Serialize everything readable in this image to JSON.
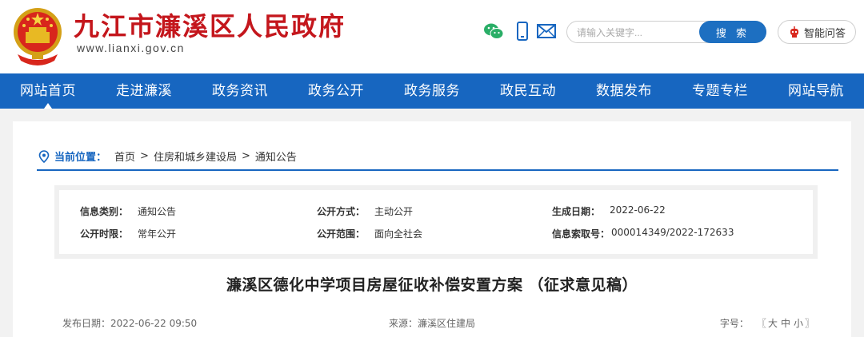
{
  "header": {
    "site_title": "九江市濂溪区人民政府",
    "site_domain": "www.lianxi.gov.cn",
    "icons": [
      "wechat-icon",
      "mobile-icon",
      "mail-icon"
    ],
    "search": {
      "placeholder": "请输入关键字...",
      "button_label": "搜 索"
    },
    "qa_label": "智能问答",
    "colors": {
      "title_red": "#c4161c",
      "nav_blue": "#1766c0",
      "search_blue": "#1d6fc1",
      "wechat_green": "#2aae67"
    }
  },
  "nav": {
    "items": [
      "网站首页",
      "走进濂溪",
      "政务资讯",
      "政务公开",
      "政务服务",
      "政民互动",
      "数据发布",
      "专题专栏",
      "网站导航"
    ],
    "active": "网站首页"
  },
  "breadcrumb": {
    "label": "当前位置：",
    "items": [
      "首页",
      "住房和城乡建设局",
      "通知公告"
    ],
    "separator": ">"
  },
  "info": {
    "category_key": "信息类别：",
    "category_val": "通知公告",
    "method_key": "公开方式：",
    "method_val": "主动公开",
    "date_key": "生成日期：",
    "date_val": "2022-06-22",
    "period_key": "公开时限：",
    "period_val": "常年公开",
    "scope_key": "公开范围：",
    "scope_val": "面向全社会",
    "index_key": "信息索取号：",
    "index_val": "000014349/2022-172633"
  },
  "article": {
    "title": "濂溪区德化中学项目房屋征收补偿安置方案 （征求意见稿）",
    "publish_label": "发布日期：",
    "publish_date": "2022-06-22 09:50",
    "source_label": "来源：",
    "source": "濂溪区住建局",
    "font_label": "字号：",
    "font_open": "〖",
    "font_sizes": [
      "大",
      "中",
      "小"
    ],
    "font_close": "〗"
  }
}
